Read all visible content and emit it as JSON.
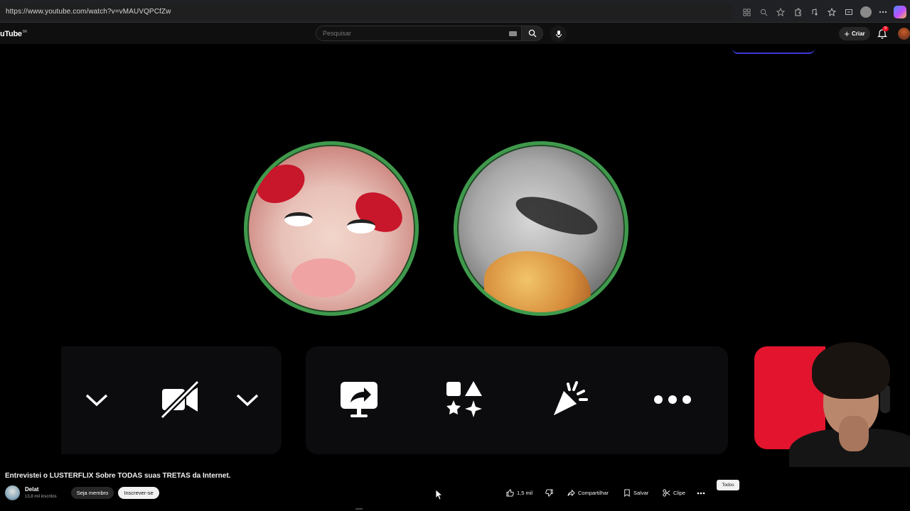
{
  "browser": {
    "url": "https://www.youtube.com/watch?v=vMAUVQPCfZw"
  },
  "header": {
    "logo": "uTube",
    "logo_region": "BR",
    "search_placeholder": "Pesquisar",
    "create_label": "Criar",
    "notification_count": "9"
  },
  "video": {
    "title": "Entrevistei o LUSTERFLIX Sobre TODAS suas TRETAS da Internet."
  },
  "channel": {
    "name": "Delat",
    "subscribers": "13,8 mil inscritos",
    "member_button": "Seja membro",
    "subscribe_button": "Inscrever-se"
  },
  "actions": {
    "likes": "1,5 mil",
    "share": "Compartilhar",
    "save": "Salvar",
    "clip": "Clipe",
    "tooltip": "Todos"
  },
  "colors": {
    "accent_red": "#e3142e",
    "avatar_ring": "#3f9a4c",
    "panel_bg": "#0c0c0e"
  }
}
